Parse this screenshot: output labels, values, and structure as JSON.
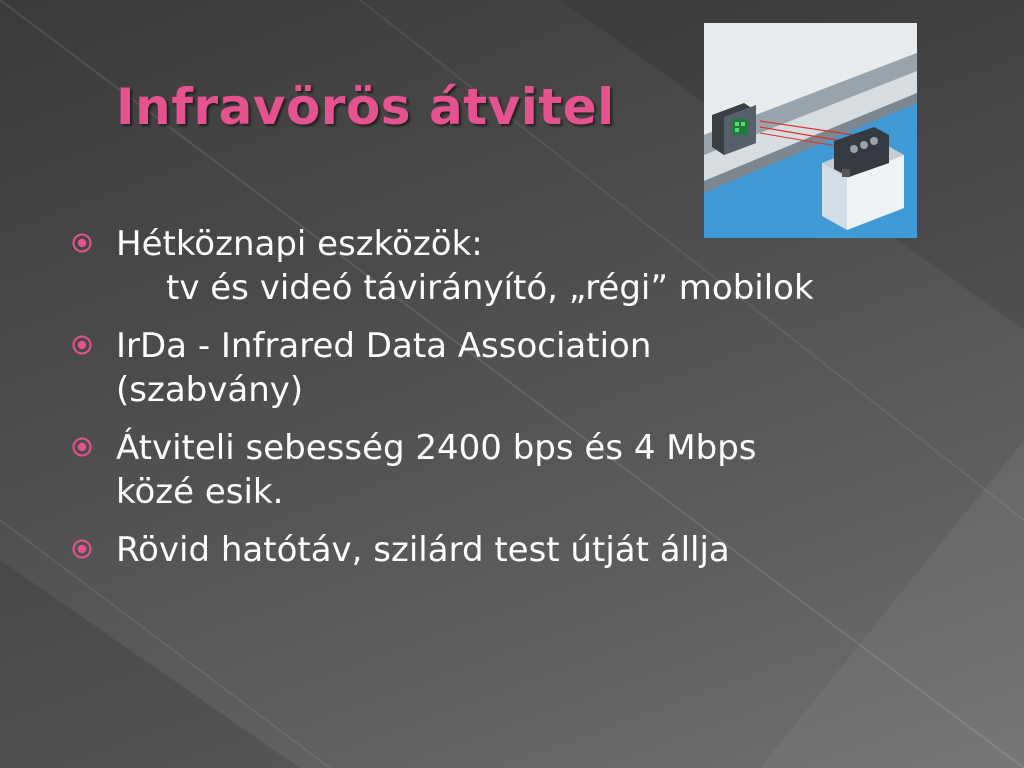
{
  "slide": {
    "title": "Infravörös átvitel",
    "accent_color": "#e4528f",
    "image_icon": "infrared-receiver-device-photo",
    "bullets": [
      {
        "lines": [
          "Hétköznapi eszközök:",
          "tv és videó távirányító, „régi” mobilok"
        ]
      },
      {
        "lines": [
          " IrDa - Infrared Data Association",
          "(szabvány)"
        ]
      },
      {
        "lines": [
          "Átviteli sebesség 2400 bps és 4 Mbps",
          "közé esik."
        ]
      },
      {
        "lines": [
          "Rövid hatótáv, szilárd test útját állja"
        ]
      }
    ]
  }
}
